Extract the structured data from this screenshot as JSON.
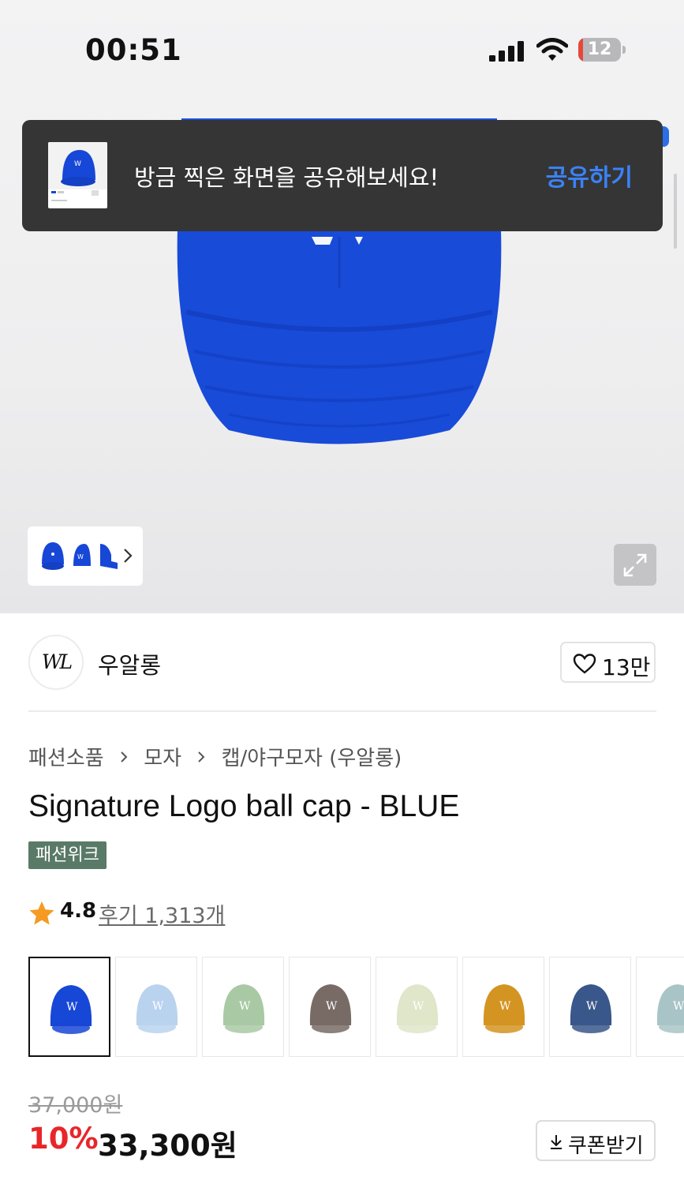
{
  "status_bar": {
    "time": "00:51",
    "battery": "12",
    "battery_level_percent": 12
  },
  "toast": {
    "message": "방금 찍은 화면을 공유해보세요!",
    "action_label": "공유하기",
    "action_color": "#3b82f6"
  },
  "gallery": {
    "thumbnail_count": 3,
    "next_icon": "chevron-right-icon",
    "expand_icon": "expand-icon"
  },
  "brand": {
    "logo_text": "WL",
    "name": "우알롱",
    "like_count": "13만"
  },
  "breadcrumb": {
    "items": [
      "패션소품",
      "모자",
      "캡/야구모자 (우알롱)"
    ]
  },
  "product": {
    "title": "Signature Logo ball cap - BLUE",
    "badge": "패션위크",
    "badge_color": "#5a7a68",
    "rating": "4.8",
    "review_label": "후기 1,313개"
  },
  "color_options": [
    {
      "color": "#1747d6",
      "selected": true
    },
    {
      "color": "#b9d3ee",
      "selected": false
    },
    {
      "color": "#a9c9a4",
      "selected": false
    },
    {
      "color": "#786b66",
      "selected": false
    },
    {
      "color": "#dfe6c9",
      "selected": false
    },
    {
      "color": "#d49422",
      "selected": false
    },
    {
      "color": "#39578a",
      "selected": false
    },
    {
      "color": "#a9c4c6",
      "selected": false
    }
  ],
  "price": {
    "original": "37,000원",
    "discount": "10%",
    "sale": "33,300원",
    "discount_color": "#e8262a",
    "coupon_label": "쿠폰받기"
  }
}
